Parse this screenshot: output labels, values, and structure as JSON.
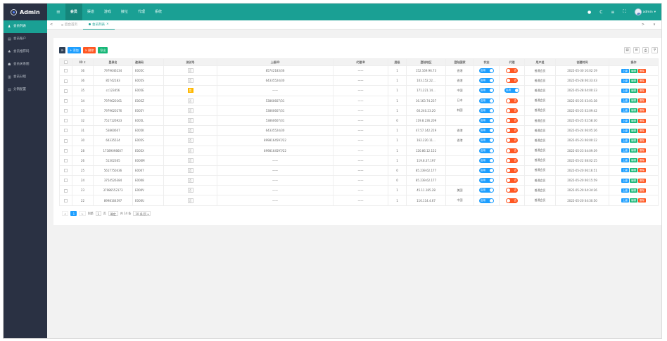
{
  "logo": {
    "text": "Admin"
  },
  "topnav": {
    "menu_icon": "≡",
    "items": [
      "会员",
      "渠道",
      "游戏",
      "接址",
      "代理",
      "系统"
    ]
  },
  "user": {
    "name": "admin"
  },
  "topright_icons": [
    "●",
    "C",
    "≡",
    "⛶"
  ],
  "sidebar": {
    "items": [
      {
        "label": "会员列表",
        "icon": "♟"
      },
      {
        "label": "会员账户",
        "icon": "▤"
      },
      {
        "label": "会员推荐码",
        "icon": "♣"
      },
      {
        "label": "会员关系图",
        "icon": "☗"
      },
      {
        "label": "会员分组",
        "icon": "▥"
      },
      {
        "label": "分销配置",
        "icon": "▤"
      }
    ]
  },
  "tabs": {
    "left_arrow": "<",
    "right_arrow": ">",
    "down_arrow": "∨",
    "items": [
      {
        "label": "后台首页"
      },
      {
        "label": "会员列表"
      }
    ]
  },
  "toolbar": {
    "refresh": "⟳",
    "add": "+ 添加",
    "delete": "✕ 删除",
    "export": "导出"
  },
  "tools": [
    "▤",
    "⊟",
    "⎙",
    "⚲"
  ],
  "table": {
    "headers": [
      "ID",
      "登录名",
      "邀请码",
      "测试号",
      "上级ID",
      "代理ID",
      "层级",
      "登陆地区",
      "登陆国家",
      "状态",
      "代理",
      "用户组",
      "创建时间",
      "操作"
    ],
    "switch_on": "启用",
    "switch_off": "否",
    "actions": [
      "上级",
      "编辑",
      "删除"
    ],
    "rows": [
      {
        "id": "36",
        "login": "7979646234",
        "code": "E005C",
        "test": "否",
        "parent": "85742183/36",
        "agent": "——",
        "level": "1",
        "area": "152.169.96.73",
        "country": "香港",
        "status": true,
        "proxy": false,
        "group": "普通会员",
        "time": "2022-05-30 10:02:19"
      },
      {
        "id": "36",
        "login": "85742183",
        "code": "E005S",
        "test": "否",
        "parent": "64335524/30",
        "agent": "——",
        "level": "1",
        "area": "103.152.22...",
        "country": "香港",
        "status": true,
        "proxy": false,
        "group": "普通会员",
        "time": "2022-05-28 06:33:43"
      },
      {
        "id": "35",
        "login": "cc123456",
        "code": "E005E",
        "test": "是",
        "parent": "——",
        "agent": "——",
        "level": "1",
        "area": "171.221.14...",
        "country": "中国",
        "status": true,
        "proxy": true,
        "group": "普通会员",
        "time": "2022-05-28 04:00:33"
      },
      {
        "id": "34",
        "login": "7979620161",
        "code": "E005Z",
        "test": "否",
        "parent": "53860607/31",
        "agent": "——",
        "level": "1",
        "area": "16.163.74.237",
        "country": "日本",
        "status": true,
        "proxy": false,
        "group": "普通会员",
        "time": "2022-05-25 03:01:38"
      },
      {
        "id": "33",
        "login": "7979620276",
        "code": "E005Y",
        "test": "否",
        "parent": "53860607/31",
        "agent": "——",
        "level": "1",
        "area": "60.240.23.20",
        "country": "韩国",
        "status": true,
        "proxy": false,
        "group": "普通会员",
        "time": "2022-05-25 02:09:42"
      },
      {
        "id": "32",
        "login": "7517126923",
        "code": "E005L",
        "test": "否",
        "parent": "53860607/31",
        "agent": "——",
        "level": "0",
        "area": "119.8.236.209",
        "country": "",
        "status": true,
        "proxy": false,
        "group": "普通会员",
        "time": "2022-05-25 02:58:30"
      },
      {
        "id": "31",
        "login": "53860607",
        "code": "E005K",
        "test": "否",
        "parent": "64335524/30",
        "agent": "——",
        "level": "1",
        "area": "47.57.142.219",
        "country": "香港",
        "status": true,
        "proxy": false,
        "group": "普通会员",
        "time": "2022-05-24 06:05:26"
      },
      {
        "id": "30",
        "login": "64335524",
        "code": "E005S",
        "test": "否",
        "parent": "8998164597/22",
        "agent": "——",
        "level": "1",
        "area": "162.220.11...",
        "country": "香港",
        "status": true,
        "proxy": false,
        "group": "普通会员",
        "time": "2022-05-23 06:00:22"
      },
      {
        "id": "28",
        "login": "17389098607",
        "code": "E005X",
        "test": "否",
        "parent": "8998164597/22",
        "agent": "——",
        "level": "1",
        "area": "120.86.12.152",
        "country": "",
        "status": true,
        "proxy": false,
        "group": "普通会员",
        "time": "2022-05-23 04:09:39"
      },
      {
        "id": "26",
        "login": "51302365",
        "code": "E000M",
        "test": "否",
        "parent": "——",
        "agent": "——",
        "level": "1",
        "area": "119.8.37.197",
        "country": "",
        "status": true,
        "proxy": false,
        "group": "普通会员",
        "time": "2022-05-22 08:02:25"
      },
      {
        "id": "25",
        "login": "5617750436",
        "code": "E0007",
        "test": "否",
        "parent": "——",
        "agent": "——",
        "level": "0",
        "area": "85.239.62.177",
        "country": "",
        "status": true,
        "proxy": false,
        "group": "普通会员",
        "time": "2022-05-20 06:16:51"
      },
      {
        "id": "24",
        "login": "3754526384",
        "code": "E0008",
        "test": "否",
        "parent": "——",
        "agent": "——",
        "level": "0",
        "area": "85.239.62.177",
        "country": "",
        "status": true,
        "proxy": false,
        "group": "普通会员",
        "time": "2022-05-20 06:15:59"
      },
      {
        "id": "23",
        "login": "37986552173",
        "code": "E000V",
        "test": "否",
        "parent": "——",
        "agent": "——",
        "level": "1",
        "area": "45.11.185.28",
        "country": "美国",
        "status": true,
        "proxy": false,
        "group": "普通会员",
        "time": "2022-05-20 04:34:26"
      },
      {
        "id": "22",
        "login": "8998164597",
        "code": "E000U",
        "test": "否",
        "parent": "——",
        "agent": "——",
        "level": "1",
        "area": "116.114.4.67",
        "country": "中国",
        "status": true,
        "proxy": false,
        "group": "普通会员",
        "time": "2022-05-20 04:30:50"
      }
    ]
  },
  "pager": {
    "prev": "<",
    "current": "1",
    "next": ">",
    "goto_label": "到第",
    "goto_value": "1",
    "page_unit": "页",
    "confirm": "确定",
    "total": "共 14 条",
    "per_page": "10 条/页"
  }
}
